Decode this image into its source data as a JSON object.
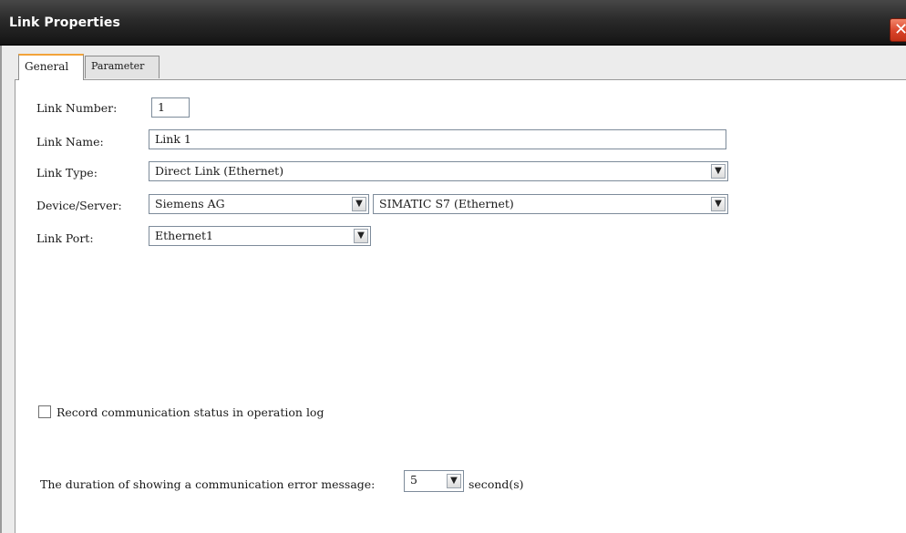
{
  "window": {
    "title": "Link Properties",
    "close_glyph": "✕"
  },
  "tabs": [
    {
      "label": "General",
      "active": true
    },
    {
      "label": "Parameter",
      "active": false
    }
  ],
  "form": {
    "link_number": {
      "label": "Link Number:",
      "value": "1"
    },
    "link_name": {
      "label": "Link Name:",
      "value": "Link 1"
    },
    "link_type": {
      "label": "Link Type:",
      "value": "Direct Link (Ethernet)"
    },
    "device_server": {
      "label": "Device/Server:",
      "vendor": "Siemens AG",
      "model": "SIMATIC S7 (Ethernet)"
    },
    "link_port": {
      "label": "Link Port:",
      "value": "Ethernet1"
    }
  },
  "options": {
    "record_log": {
      "label": "Record communication status in operation log",
      "checked": false
    },
    "error_duration": {
      "label": "The duration of showing a communication error message:",
      "value": "5",
      "unit": "second(s)"
    }
  },
  "icons": {
    "dropdown": "chevron-down-icon",
    "close": "close-icon"
  },
  "colors": {
    "titlebar": "#1e1e1e",
    "close": "#d9442a",
    "active_tab_accent": "#f2a33a"
  }
}
